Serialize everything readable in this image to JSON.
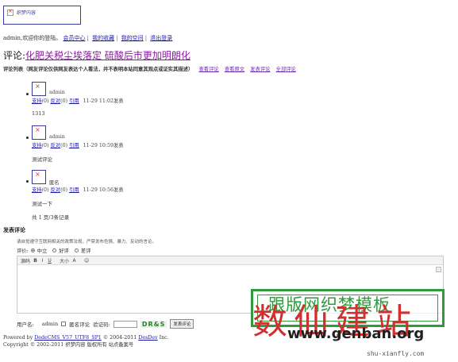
{
  "logo": {
    "alt": "织梦内容"
  },
  "topnav": {
    "prefix": "admin,欢迎你的登陆。",
    "links": [
      "会员中心",
      "我的收藏",
      "我的空间",
      "退出登录"
    ]
  },
  "article": {
    "prefix": "评论:",
    "title": "化肥关税尘埃落定 硫酸后市更加明朗化"
  },
  "comment_list": {
    "heading": "评论列表（网友评论仅供网友表达个人看法，并不表明本站同意其观点或证实其描述）",
    "links": [
      "查看评论",
      "查看原文",
      "发表评论",
      "全部评论"
    ]
  },
  "comments": [
    {
      "user": "admin",
      "meta_links": [
        "支持",
        "反对",
        "引用"
      ],
      "counts": [
        "(0)",
        "(0)"
      ],
      "date": "11-29 11:02发表",
      "text": "1313"
    },
    {
      "user": "admin",
      "meta_links": [
        "支持",
        "反对",
        "引用"
      ],
      "counts": [
        "(0)",
        "(0)"
      ],
      "date": "11-29 10:59发表",
      "text": "测试评论"
    },
    {
      "user": "匿名",
      "meta_links": [
        "支持",
        "反对",
        "引用"
      ],
      "counts": [
        "(0)",
        "(0)"
      ],
      "date": "11-29 10:56发表",
      "text": "测试一下"
    }
  ],
  "pagination": "共 1 页/3条记录",
  "post": {
    "heading": "发表评论",
    "notice": "请自觉遵守互联网相关的政策法规，严禁发布色情、暴力、反动的言论。",
    "rating_label": "评价:",
    "ratings": [
      "中立",
      "好评",
      "差评"
    ],
    "toolbar": [
      "源码",
      "B",
      "I",
      "U",
      "大小",
      "A",
      "☺"
    ],
    "username_label": "用户名:",
    "username": "admin",
    "anon_label": "匿名评论",
    "captcha_label": "验证码:",
    "captcha": "DR&S",
    "submit": "发表评论"
  },
  "footer": {
    "line1_prefix": "Powered by ",
    "powered_link": "DedeCMS_V57_UTF8_SP1",
    "line1_mid": " © 2004-2011 ",
    "company_link": "DesDev",
    "line1_suffix": " Inc.",
    "line2": "Copyright © 2002-2011 织梦内容 版权所有 站点备案号"
  },
  "watermark": {
    "title": "跟版网织梦模板",
    "big": "数仙建站",
    "url": "www.genban.org",
    "small": "shu-xianfly.com"
  }
}
